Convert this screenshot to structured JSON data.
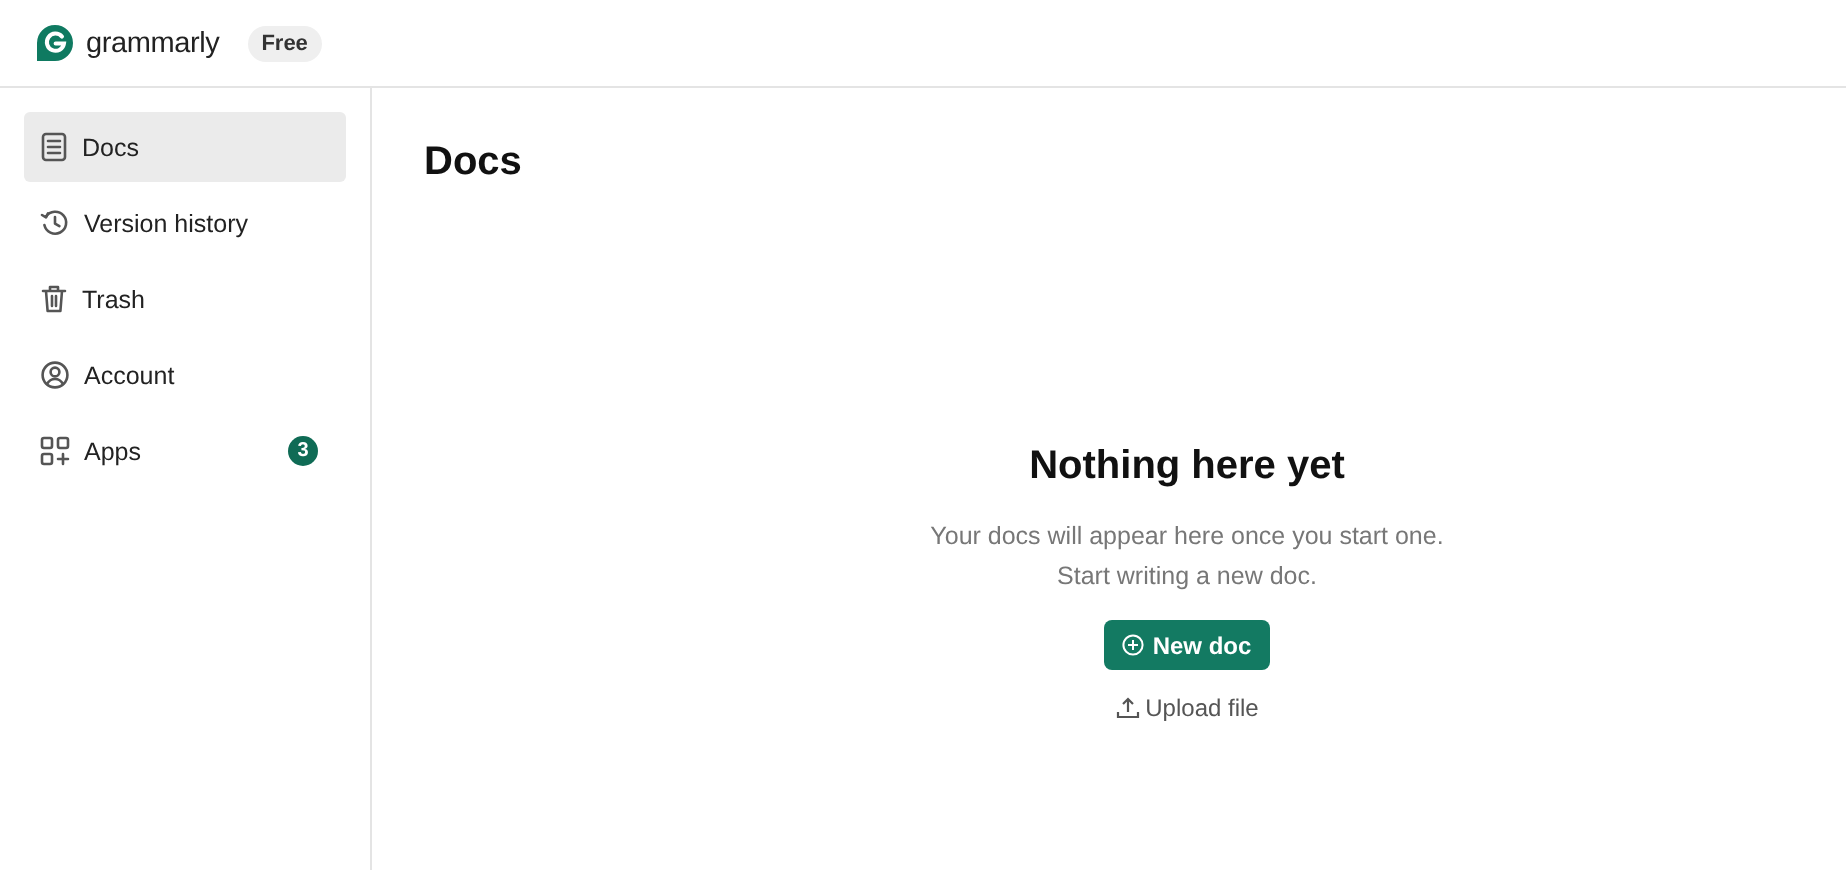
{
  "header": {
    "logo_text": "grammarly",
    "plan_badge": "Free"
  },
  "sidebar": {
    "items": [
      {
        "label": "Docs",
        "selected": true
      },
      {
        "label": "Version history",
        "selected": false
      },
      {
        "label": "Trash",
        "selected": false
      },
      {
        "label": "Account",
        "selected": false
      },
      {
        "label": "Apps",
        "selected": false,
        "badge": "3"
      }
    ]
  },
  "main": {
    "title": "Docs",
    "empty_state": {
      "heading": "Nothing here yet",
      "lines": [
        "Your docs will appear here once you start one.",
        "Start writing a new doc."
      ],
      "primary_button": "New doc",
      "secondary_link": "Upload file"
    }
  }
}
